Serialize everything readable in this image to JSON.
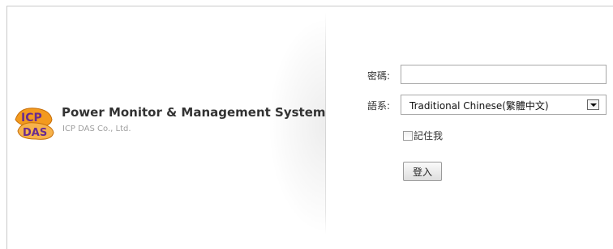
{
  "brand": {
    "title": "Power Monitor & Management System",
    "subtitle": "ICP DAS Co., Ltd.",
    "logo_text_top": "ICP",
    "logo_text_bottom": "DAS"
  },
  "login_form": {
    "password_label": "密碼:",
    "password_value": "",
    "language_label": "語系:",
    "language_selected": "Traditional Chinese(繁體中文)",
    "remember_label": "記住我",
    "remember_checked": false,
    "login_button": "登入"
  },
  "colors": {
    "logo_orange": "#f39a1e",
    "logo_purple": "#6a2c8e"
  }
}
